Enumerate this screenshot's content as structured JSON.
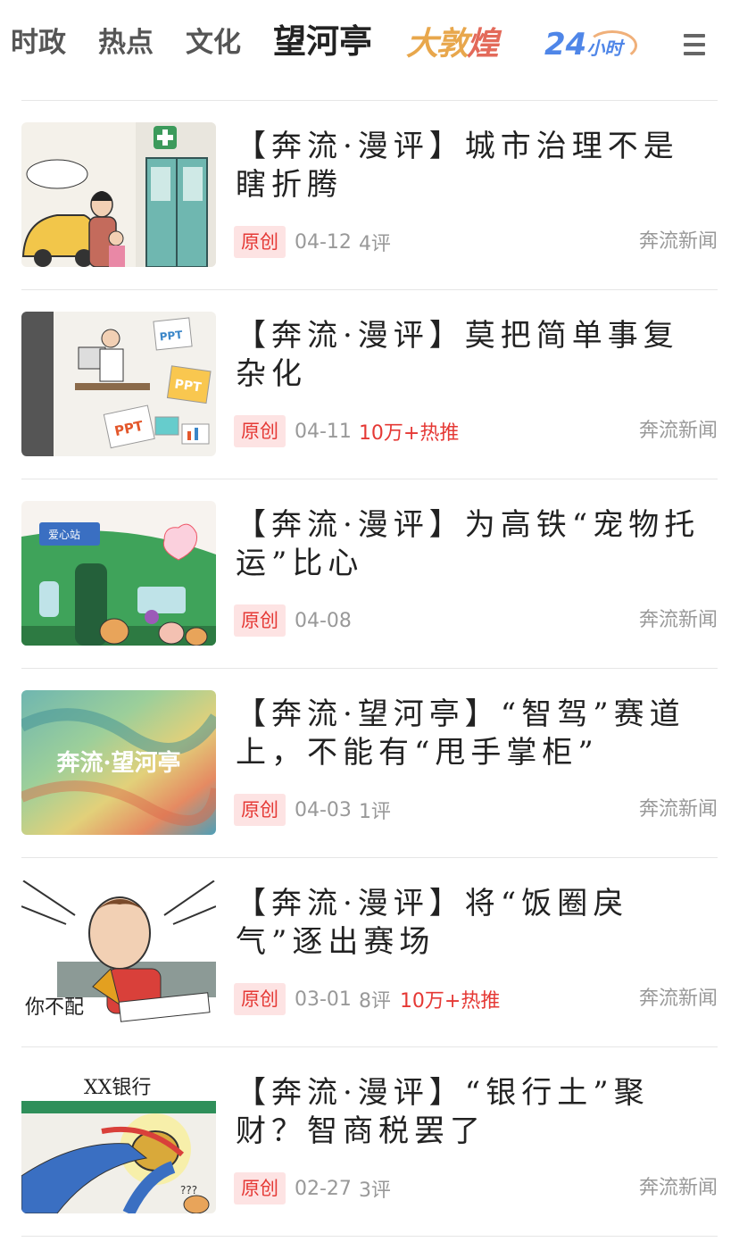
{
  "nav": {
    "tabs": [
      {
        "label": "时政"
      },
      {
        "label": "热点"
      },
      {
        "label": "文化"
      },
      {
        "label": "望河亭",
        "active": true
      }
    ],
    "logo_dunhuang": "大敦煌",
    "logo_24_num": "24",
    "logo_24_text": "小时",
    "menu_icon": "hamburger-menu-icon"
  },
  "colors": {
    "badge_bg": "#fde3e3",
    "badge_text": "#e53935",
    "hot_text": "#e53935",
    "meta_text": "#999999"
  },
  "articles": [
    {
      "title": "【奔流·漫评】城市治理不是瞎折腾",
      "badge": "原创",
      "date": "04-12",
      "comments": "4评",
      "hot": "",
      "source": "奔流新闻",
      "thumb": "cartoon-hospital"
    },
    {
      "title": "【奔流·漫评】莫把简单事复杂化",
      "badge": "原创",
      "date": "04-11",
      "comments": "",
      "hot": "10万+热推",
      "source": "奔流新闻",
      "thumb": "cartoon-ppt",
      "thumb_text": {
        "ppt1": "PPT",
        "ppt2": "PPT",
        "ppt3": "PPT"
      }
    },
    {
      "title": "【奔流·漫评】为高铁“宠物托运”比心",
      "badge": "原创",
      "date": "04-08",
      "comments": "",
      "hot": "",
      "source": "奔流新闻",
      "thumb": "cartoon-train",
      "thumb_text": {
        "sign": "爱心站"
      }
    },
    {
      "title": "【奔流·望河亭】“智驾”赛道上，不能有“甩手掌柜”",
      "badge": "原创",
      "date": "04-03",
      "comments": "1评",
      "hot": "",
      "source": "奔流新闻",
      "thumb": "banner-wanghetin",
      "thumb_text": {
        "banner": "奔流·望河亭"
      }
    },
    {
      "title": "【奔流·漫评】将“饭圈戾气”逐出赛场",
      "badge": "原创",
      "date": "03-01",
      "comments": "8评",
      "hot": "10万+热推",
      "source": "奔流新闻",
      "thumb": "cartoon-athlete",
      "thumb_text": {
        "scrawl": "你不配"
      }
    },
    {
      "title": "【奔流·漫评】“银行土”聚财？智商税罢了",
      "badge": "原创",
      "date": "02-27",
      "comments": "3评",
      "hot": "",
      "source": "奔流新闻",
      "thumb": "cartoon-bank",
      "thumb_text": {
        "bank_sign": "XX银行",
        "question": "???"
      }
    }
  ]
}
